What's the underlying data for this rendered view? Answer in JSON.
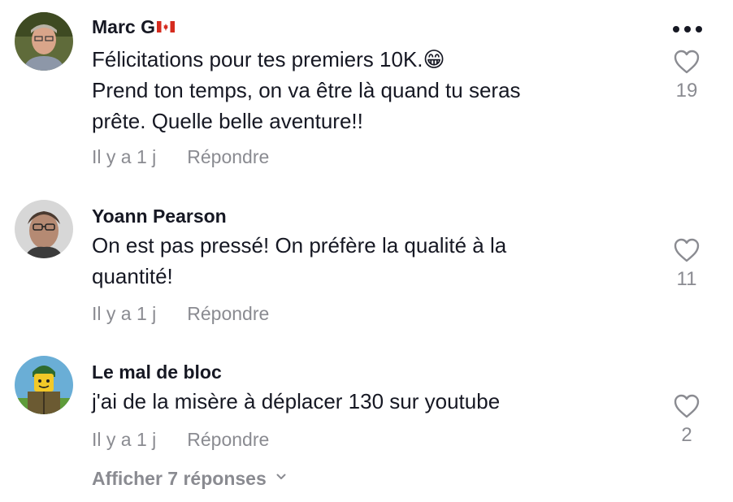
{
  "menu_icon": "more-horizontal-icon",
  "comments": [
    {
      "author": "Marc G",
      "author_flag": "canada-flag-icon",
      "lines": [
        "Félicitations pour tes premiers 10K.😁",
        "Prend ton temps, on va être là quand tu seras",
        "prête. Quelle belle aventure!!"
      ],
      "time": "Il y a 1 j",
      "reply_label": "Répondre",
      "likes": "19"
    },
    {
      "author": "Yoann Pearson",
      "lines": [
        "On est pas pressé! On préfère la qualité à la",
        "quantité!"
      ],
      "time": "Il y a 1 j",
      "reply_label": "Répondre",
      "likes": "11"
    },
    {
      "author": "Le mal de bloc",
      "lines": [
        "j'ai de la misère à déplacer 130 sur youtube"
      ],
      "time": "Il y a 1 j",
      "reply_label": "Répondre",
      "likes": "2"
    }
  ],
  "view_replies": "Afficher 7 réponses",
  "colors": {
    "text": "#161823",
    "muted": "#8a8b91",
    "background": "#ffffff"
  }
}
